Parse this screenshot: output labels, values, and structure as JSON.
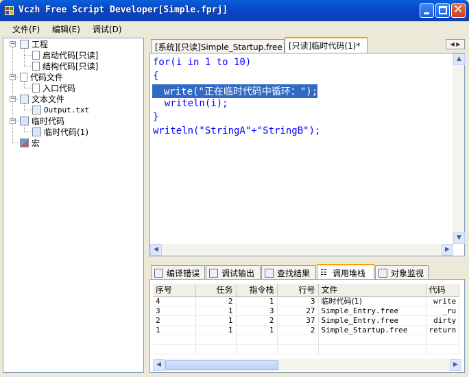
{
  "window": {
    "title": "Vczh Free Script Developer[Simple.fprj]"
  },
  "menu": [
    {
      "label": "文件(F)"
    },
    {
      "label": "编辑(E)"
    },
    {
      "label": "调试(D)"
    }
  ],
  "tree": {
    "project": "工程",
    "startup_code": "启动代码[只读]",
    "struct_code": "结构代码[只读]",
    "code_files": "代码文件",
    "entry_code": "入口代码",
    "text_files": "文本文件",
    "output_txt": "Output.txt",
    "temp_code": "临时代码",
    "temp_code_1": "临时代码(1)",
    "macro": "宏"
  },
  "editor_tabs": [
    {
      "label": "[系统][只读]Simple_Startup.free"
    },
    {
      "label": "[只读]临时代码(1)*"
    }
  ],
  "code_lines": [
    "for(i in 1 to 10)",
    "{",
    "  write(\"正在临时代码中循环：\");",
    "  writeln(i);",
    "}",
    "writeln(\"StringA\"+\"StringB\");"
  ],
  "bottom_tabs": [
    {
      "label": "编译错误"
    },
    {
      "label": "调试输出"
    },
    {
      "label": "查找结果"
    },
    {
      "label": "调用堆栈"
    },
    {
      "label": "对象监视"
    }
  ],
  "stack_table": {
    "columns": [
      "序号",
      "任务",
      "指令栈",
      "行号",
      "文件",
      "代码"
    ],
    "rows": [
      [
        "4",
        "2",
        "1",
        "3",
        "临时代码(1)",
        "write"
      ],
      [
        "3",
        "1",
        "3",
        "27",
        "Simple_Entry.free",
        "_ru"
      ],
      [
        "2",
        "1",
        "2",
        "37",
        "Simple_Entry.free",
        "dirty"
      ],
      [
        "1",
        "1",
        "1",
        "2",
        "Simple_Startup.free",
        "return"
      ]
    ]
  },
  "colors": {
    "keyword": "#0000ff",
    "string": "#a31515",
    "selection": "#316ac5",
    "titlebar": "#0a5fd8"
  }
}
